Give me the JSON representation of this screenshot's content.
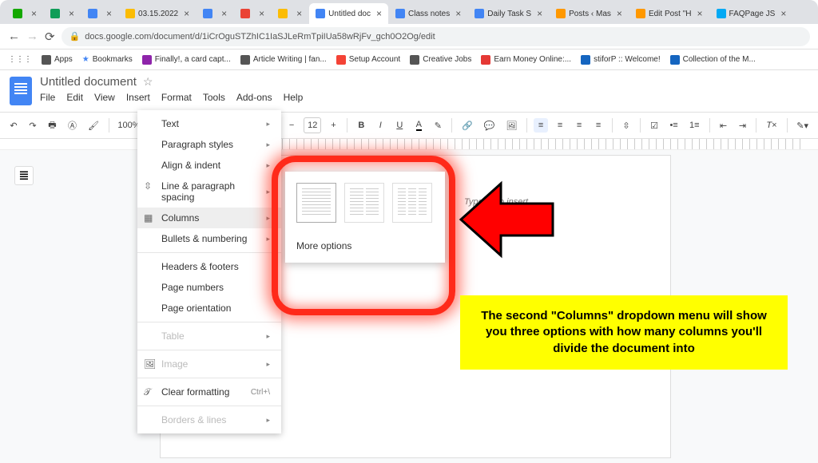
{
  "tabs": [
    {
      "label": "",
      "color": "#14a800"
    },
    {
      "label": "",
      "color": "#0f9d58"
    },
    {
      "label": "",
      "color": "#4285f4"
    },
    {
      "label": "03.15.2022",
      "color": "#fbbc04"
    },
    {
      "label": "",
      "color": "#4285f4"
    },
    {
      "label": "",
      "color": "#ea4335"
    },
    {
      "label": "",
      "color": "#fbbc04"
    },
    {
      "label": "Untitled doc",
      "color": "#4285f4",
      "active": true
    },
    {
      "label": "Class notes",
      "color": "#4285f4"
    },
    {
      "label": "Daily Task S",
      "color": "#4285f4"
    },
    {
      "label": "Posts ‹ Mas",
      "color": "#ff9800"
    },
    {
      "label": "Edit Post \"H",
      "color": "#ff9800"
    },
    {
      "label": "FAQPage JS",
      "color": "#03a9f4"
    }
  ],
  "url": "docs.google.com/document/d/1iCrOguSTZhIC1IaSJLeRmTpiIUa58wRjFv_gch0O2Og/edit",
  "bookmarks": [
    {
      "label": "Apps",
      "color": "#555"
    },
    {
      "label": "Bookmarks",
      "color": "#4285f4",
      "star": true
    },
    {
      "label": "Finally!, a card capt...",
      "color": "#8e24aa"
    },
    {
      "label": "Article Writing | fan...",
      "color": "#555"
    },
    {
      "label": "Setup Account",
      "color": "#f44336"
    },
    {
      "label": "Creative Jobs",
      "color": "#555"
    },
    {
      "label": "Earn Money Online:...",
      "color": "#e53935"
    },
    {
      "label": "stiforP :: Welcome!",
      "color": "#1565c0"
    },
    {
      "label": "Collection of the M...",
      "color": "#1565c0"
    }
  ],
  "doc": {
    "title": "Untitled document"
  },
  "menus": [
    "File",
    "Edit",
    "View",
    "Insert",
    "Format",
    "Tools",
    "Add-ons",
    "Help"
  ],
  "toolbar": {
    "zoom": "100%",
    "style": "",
    "font": "",
    "size": "12"
  },
  "format_menu": {
    "text": "Text",
    "paragraph": "Paragraph styles",
    "align": "Align & indent",
    "spacing": "Line & paragraph spacing",
    "columns": "Columns",
    "bullets": "Bullets & numbering",
    "headers": "Headers & footers",
    "pagenums": "Page numbers",
    "orientation": "Page orientation",
    "table": "Table",
    "image": "Image",
    "clear": "Clear formatting",
    "clear_shortcut": "Ctrl+\\",
    "borders": "Borders & lines"
  },
  "submenu": {
    "more": "More options"
  },
  "page_hint": "Type @ to insert",
  "callout": "The second \"Columns\" dropdown menu will show you three options with how many columns you'll divide the document into"
}
